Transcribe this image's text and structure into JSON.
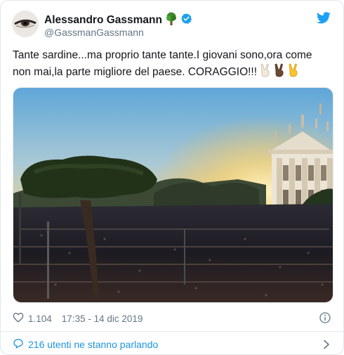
{
  "tweet": {
    "author_name": "Alessandro Gassmann",
    "author_handle": "@GassmanGassmann",
    "text": "Tante sardine...ma proprio tante tante.I giovani sono,ora come non mai,la parte migliore del paese. CORAGGIO!!! ",
    "emoji": [
      "victory-hand-light",
      "victory-hand-dark",
      "victory-hand-yellow"
    ],
    "like_count": "1.104",
    "timestamp": "17:35 - 14 dic 2019",
    "conversation_label": "216 utenti ne stanno parlando"
  },
  "icons": {
    "tree": "tree-icon",
    "verified": "verified-badge-icon",
    "twitter": "twitter-bird-icon",
    "heart": "heart-icon",
    "info": "info-icon",
    "comment": "comment-icon",
    "chevron": "chevron-right-icon"
  },
  "colors": {
    "accent": "#1da1f2",
    "link": "#1b95e0",
    "muted": "#657786",
    "text": "#14171a",
    "border": "#e1e8ed"
  }
}
